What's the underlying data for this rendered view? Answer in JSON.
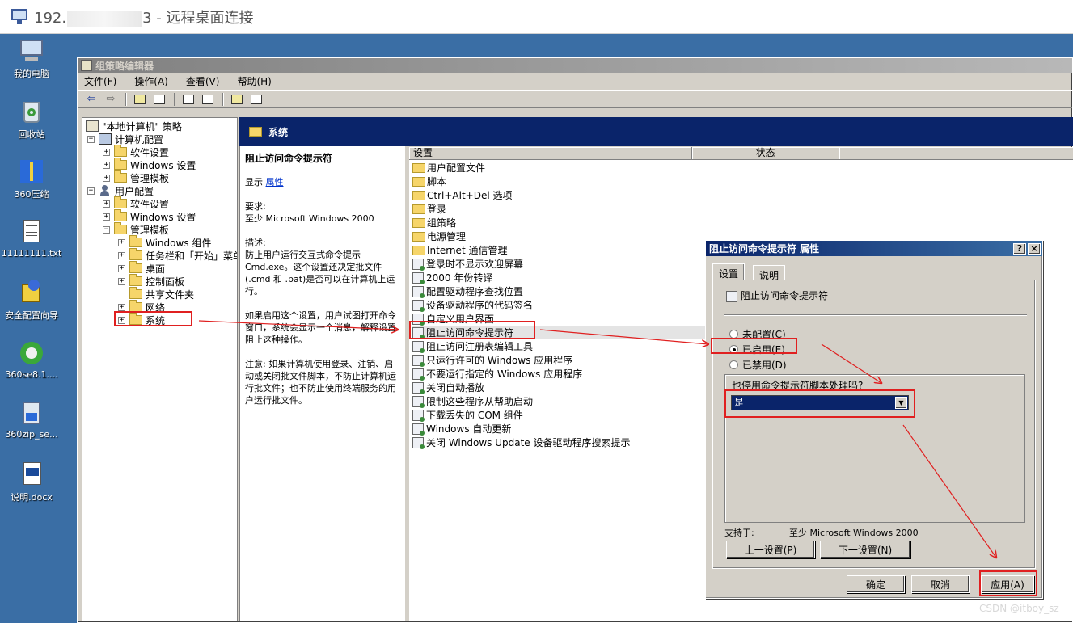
{
  "rdp": {
    "title_prefix": "192.",
    "title_suffix": "3 - 远程桌面连接"
  },
  "desktop": {
    "icons": [
      {
        "label": "我的电脑",
        "icon": "my-computer-icon"
      },
      {
        "label": "回收站",
        "icon": "recycle-bin-icon"
      },
      {
        "label": "360压缩",
        "icon": "archive-icon"
      },
      {
        "label": "11111111.txt",
        "icon": "text-file-icon"
      },
      {
        "label": "安全配置向导",
        "icon": "security-wizard-icon"
      },
      {
        "label": "360se8.1....",
        "icon": "browser-icon"
      },
      {
        "label": "360zip_se...",
        "icon": "installer-icon"
      },
      {
        "label": "说明.docx",
        "icon": "word-document-icon"
      }
    ]
  },
  "gp": {
    "title": "组策略编辑器",
    "menus": [
      "文件(F)",
      "操作(A)",
      "查看(V)",
      "帮助(H)"
    ],
    "tree": [
      {
        "label": "\"本地计算机\" 策略"
      },
      {
        "label": "计算机配置"
      },
      {
        "label": "软件设置"
      },
      {
        "label": "Windows 设置"
      },
      {
        "label": "管理模板"
      },
      {
        "label": "用户配置"
      },
      {
        "label": "软件设置"
      },
      {
        "label": "Windows 设置"
      },
      {
        "label": "管理模板"
      },
      {
        "label": "Windows 组件"
      },
      {
        "label": "任务栏和「开始」菜单"
      },
      {
        "label": "桌面"
      },
      {
        "label": "控制面板"
      },
      {
        "label": "共享文件夹"
      },
      {
        "label": "网络"
      },
      {
        "label": "系统"
      }
    ],
    "header_title": "系统",
    "description": {
      "title": "阻止访问命令提示符",
      "show": "显示",
      "link": "属性",
      "req_label": "要求:",
      "req_text": "至少 Microsoft Windows 2000",
      "desc_label": "描述:",
      "desc_text": "防止用户运行交互式命令提示 Cmd.exe。这个设置还决定批文件(.cmd 和 .bat)是否可以在计算机上运行。",
      "para2": "如果启用这个设置，用户试图打开命令窗口，系统会显示一个消息，解释设置阻止这种操作。",
      "para3": "注意: 如果计算机使用登录、注销、启动或关闭批文件脚本，不防止计算机运行批文件；也不防止使用终端服务的用户运行批文件。"
    },
    "list_columns": {
      "setting": "设置",
      "state": "状态"
    },
    "folders": [
      "用户配置文件",
      "脚本",
      "Ctrl+Alt+Del 选项",
      "登录",
      "组策略",
      "电源管理",
      "Internet 通信管理"
    ],
    "policies": [
      "登录时不显示欢迎屏幕",
      "2000 年份转译",
      "配置驱动程序查找位置",
      "设备驱动程序的代码签名",
      "自定义用户界面",
      "阻止访问命令提示符",
      "阻止访问注册表编辑工具",
      "只运行许可的 Windows 应用程序",
      "不要运行指定的 Windows 应用程序",
      "关闭自动播放",
      "限制这些程序从帮助启动",
      "下载丢失的 COM 组件",
      "Windows 自动更新",
      "关闭 Windows Update 设备驱动程序搜索提示"
    ]
  },
  "dialog": {
    "title": "阻止访问命令提示符 属性",
    "help_btn": "?",
    "close_btn": "×",
    "tabs": [
      "设置",
      "说明"
    ],
    "setting_name": "阻止访问命令提示符",
    "radio_not_configured": "未配置(C)",
    "radio_enabled": "已启用(E)",
    "radio_disabled": "已禁用(D)",
    "selected_option": "enabled",
    "option_question": "也停用命令提示符脚本处理吗?",
    "option_value": "是",
    "supported_label": "支持于:",
    "supported_value": "至少 Microsoft Windows 2000",
    "prev_btn": "上一设置(P)",
    "next_btn": "下一设置(N)",
    "ok_btn": "确定",
    "cancel_btn": "取消",
    "apply_btn": "应用(A)"
  },
  "watermark": "CSDN @itboy_sz",
  "colors": {
    "desktop": "#3a6ea5",
    "highlight": "#e02020",
    "active_title": "#0a246a"
  }
}
